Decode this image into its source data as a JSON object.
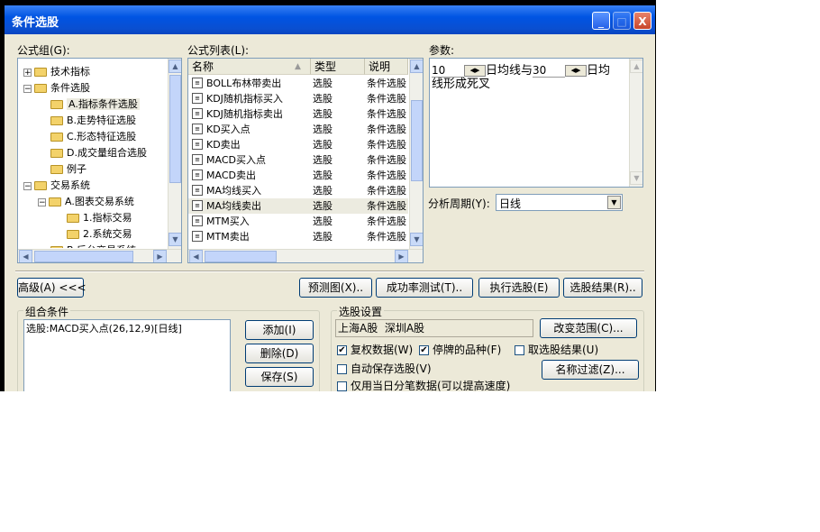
{
  "window": {
    "title": "条件选股"
  },
  "titlebar": {
    "minimize": "_",
    "maximize": "□",
    "close": "X"
  },
  "formula_group": {
    "label": "公式组(G):",
    "tree": [
      {
        "label": "技术指标",
        "expander": "+"
      },
      {
        "label": "条件选股",
        "expander": "−"
      },
      {
        "label": "A.指标条件选股",
        "expander": ""
      },
      {
        "label": "B.走势特征选股",
        "expander": ""
      },
      {
        "label": "C.形态特征选股",
        "expander": ""
      },
      {
        "label": "D.成交量组合选股",
        "expander": ""
      },
      {
        "label": "例子",
        "expander": ""
      },
      {
        "label": "交易系统",
        "expander": "−"
      },
      {
        "label": "A.图表交易系统",
        "expander": "−"
      },
      {
        "label": "1.指标交易",
        "expander": ""
      },
      {
        "label": "2.系统交易",
        "expander": ""
      },
      {
        "label": "B.后台交易系统",
        "expander": ""
      }
    ]
  },
  "formula_list": {
    "label": "公式列表(L):",
    "columns": [
      "名称",
      "类型",
      "说明"
    ],
    "rows": [
      [
        "BOLL布林带卖出",
        "选股",
        "条件选股"
      ],
      [
        "KDJ随机指标买入",
        "选股",
        "条件选股"
      ],
      [
        "KDJ随机指标卖出",
        "选股",
        "条件选股"
      ],
      [
        "KD买入点",
        "选股",
        "条件选股"
      ],
      [
        "KD卖出",
        "选股",
        "条件选股"
      ],
      [
        "MACD买入点",
        "选股",
        "条件选股"
      ],
      [
        "MACD卖出",
        "选股",
        "条件选股"
      ],
      [
        "MA均线买入",
        "选股",
        "条件选股"
      ],
      [
        "MA均线卖出",
        "选股",
        "条件选股"
      ],
      [
        "MTM买入",
        "选股",
        "条件选股"
      ],
      [
        "MTM卖出",
        "选股",
        "条件选股"
      ]
    ]
  },
  "params": {
    "label": "参数:",
    "value1": "10",
    "text1": "日均线与",
    "value2": "30",
    "text2": "日均",
    "text3": "线形成死叉"
  },
  "period": {
    "label": "分析周期(Y):",
    "value": "日线"
  },
  "toolbar": {
    "advanced": "高级(A) <<<",
    "preview": "预测图(X)..",
    "success_test": "成功率测试(T)..",
    "execute": "执行选股(E)",
    "results": "选股结果(R).."
  },
  "combo": {
    "title": "组合条件",
    "text": "选股:MACD买入点(26,12,9)[日线]",
    "add": "添加(I)",
    "delete": "删除(D)",
    "save": "保存(S)"
  },
  "settings": {
    "title": "选股设置",
    "range": "上海A股  深圳A股",
    "change_range": "改变范围(C)...",
    "restore": "复权数据(W)",
    "suspended": "停牌的品种(F)",
    "pick_result": "取选股结果(U)",
    "auto_save": "自动保存选股(V)",
    "name_filter": "名称过滤(Z)...",
    "today_only": "仅用当日分笔数据(可以提高速度)"
  }
}
